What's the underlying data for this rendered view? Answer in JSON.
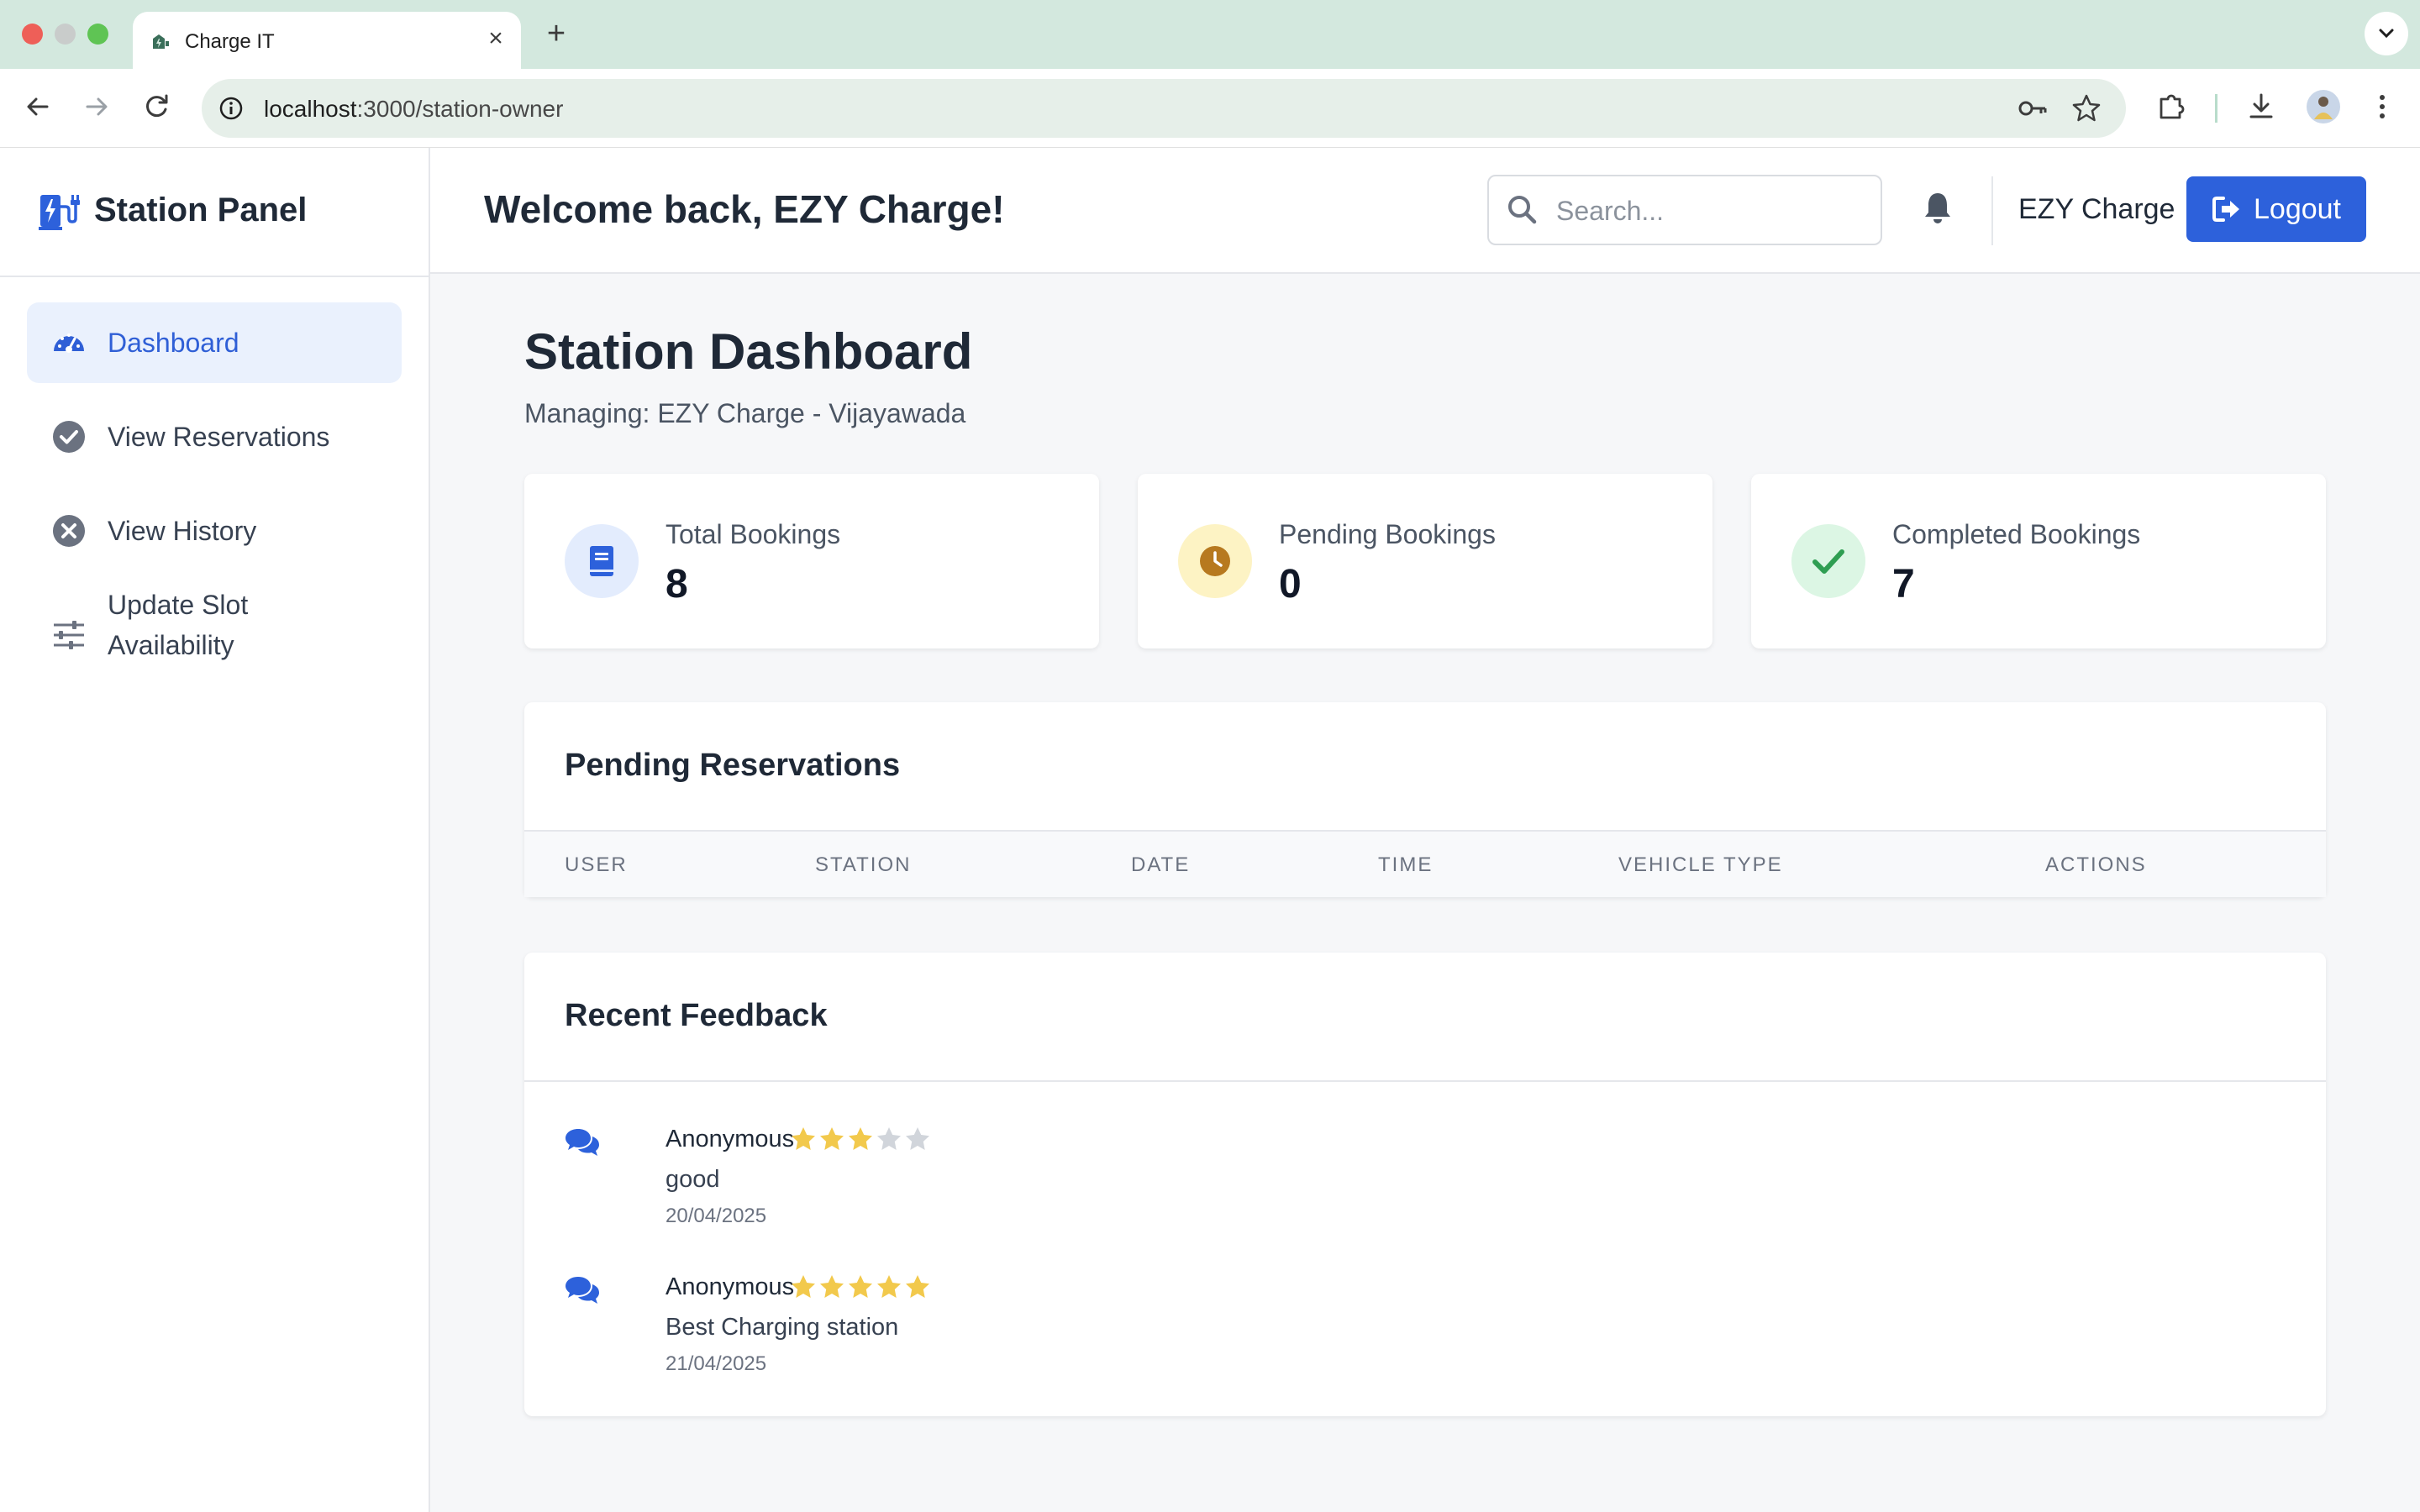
{
  "browser": {
    "tab_title": "Charge IT",
    "tab_close": "×",
    "new_tab": "+",
    "url_host": "localhost",
    "url_path": ":3000/station-owner"
  },
  "sidebar": {
    "brand": "Station Panel",
    "items": [
      {
        "label": "Dashboard",
        "icon": "gauge-icon",
        "active": true
      },
      {
        "label": "View Reservations",
        "icon": "check-circle-icon",
        "active": false
      },
      {
        "label": "View History",
        "icon": "x-circle-icon",
        "active": false
      },
      {
        "label": "Update Slot",
        "label2": "Availability",
        "icon": "sliders-icon",
        "active": false
      }
    ]
  },
  "header": {
    "welcome": "Welcome back, EZY Charge!",
    "search_placeholder": "Search...",
    "user_name": "EZY Charge",
    "logout_label": "Logout"
  },
  "dashboard": {
    "title": "Station Dashboard",
    "subtitle": "Managing: EZY Charge - Vijayawada",
    "stats": [
      {
        "label": "Total Bookings",
        "value": "8",
        "icon": "book-icon",
        "color": "#2d61db",
        "bg": "#e3ecfd"
      },
      {
        "label": "Pending Bookings",
        "value": "0",
        "icon": "clock-icon",
        "color": "#b7791f",
        "bg": "#fdf3c4"
      },
      {
        "label": "Completed Bookings",
        "value": "7",
        "icon": "check-icon",
        "color": "#2f9e52",
        "bg": "#dcf6e4"
      }
    ]
  },
  "pending": {
    "title": "Pending Reservations",
    "columns": [
      "USER",
      "STATION",
      "DATE",
      "TIME",
      "VEHICLE TYPE",
      "ACTIONS"
    ],
    "rows": []
  },
  "feedback": {
    "title": "Recent Feedback",
    "items": [
      {
        "user": "Anonymous",
        "rating": 3,
        "comment": "good",
        "date": "20/04/2025"
      },
      {
        "user": "Anonymous",
        "rating": 5,
        "comment": "Best Charging station",
        "date": "21/04/2025"
      }
    ]
  },
  "colors": {
    "accent": "#2d61db",
    "star_filled": "#f2c94c",
    "star_empty": "#d1d5db"
  }
}
